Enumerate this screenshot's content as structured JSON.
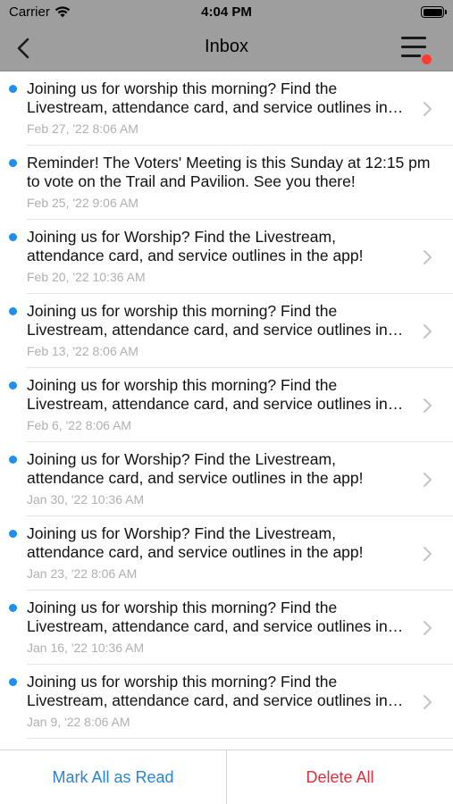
{
  "status_bar": {
    "carrier": "Carrier",
    "time": "4:04 PM"
  },
  "nav": {
    "title": "Inbox",
    "back_icon": "chevron-left-icon",
    "menu_icon": "hamburger-menu-icon",
    "menu_badge_color": "#ff3b30"
  },
  "colors": {
    "unread_dot": "#1f8ef1",
    "mark_all": "#2a83d6",
    "delete_all": "#e0303a",
    "header_bg": "#9e9e9e"
  },
  "messages": [
    {
      "text": "Joining us for worship this morning? Find the Livestream, attendance card, and service outlines in the app!",
      "date": "Feb 27, '22 8:06 AM",
      "unread": true,
      "has_chevron": true
    },
    {
      "text": "Reminder! The Voters' Meeting is this Sunday at 12:15 pm to vote on the Trail and Pavilion. See you there!",
      "date": "Feb 25, '22 9:06 AM",
      "unread": true,
      "has_chevron": false
    },
    {
      "text": "Joining us for Worship? Find the Livestream, attendance card, and service outlines in the app!",
      "date": "Feb 20, '22 10:36 AM",
      "unread": true,
      "has_chevron": true
    },
    {
      "text": "Joining us for worship this morning? Find the Livestream, attendance card, and service outlines in the app!",
      "date": "Feb 13, '22 8:06 AM",
      "unread": true,
      "has_chevron": true
    },
    {
      "text": "Joining us for worship this morning? Find the Livestream, attendance card, and service outlines in the app!",
      "date": "Feb 6, '22 8:06 AM",
      "unread": true,
      "has_chevron": true
    },
    {
      "text": "Joining us for Worship? Find the Livestream, attendance card, and service outlines in the app!",
      "date": "Jan 30, '22 10:36 AM",
      "unread": true,
      "has_chevron": true
    },
    {
      "text": "Joining us for Worship? Find the Livestream, attendance card, and service outlines in the app!",
      "date": "Jan 23, '22 8:06 AM",
      "unread": true,
      "has_chevron": true
    },
    {
      "text": "Joining us for worship this morning? Find the Livestream, attendance card, and service outlines in the app!",
      "date": "Jan 16, '22 10:36 AM",
      "unread": true,
      "has_chevron": true
    },
    {
      "text": "Joining us for worship this morning? Find the Livestream, attendance card, and service outlines in the app!",
      "date": "Jan 9, '22 8:06 AM",
      "unread": true,
      "has_chevron": true
    }
  ],
  "footer": {
    "mark_all_label": "Mark All as Read",
    "delete_all_label": "Delete All"
  }
}
